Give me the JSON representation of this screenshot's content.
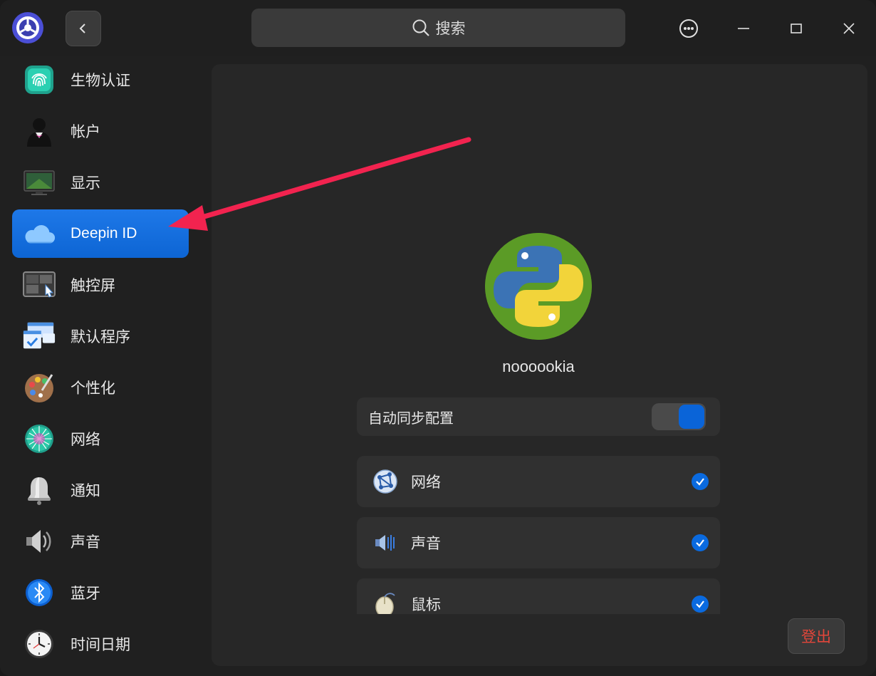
{
  "titlebar": {
    "search_placeholder": "搜索",
    "icons": [
      "control-center-icon",
      "back-icon",
      "search-icon",
      "more-icon",
      "minimize-icon",
      "maximize-icon",
      "close-icon"
    ]
  },
  "sidebar": {
    "items": [
      {
        "label": "生物认证",
        "icon": "fingerprint-icon"
      },
      {
        "label": "帐户",
        "icon": "account-icon"
      },
      {
        "label": "显示",
        "icon": "display-icon"
      },
      {
        "label": "Deepin ID",
        "icon": "cloud-icon",
        "active": true
      },
      {
        "label": "触控屏",
        "icon": "touchscreen-icon"
      },
      {
        "label": "默认程序",
        "icon": "default-apps-icon"
      },
      {
        "label": "个性化",
        "icon": "palette-icon"
      },
      {
        "label": "网络",
        "icon": "network-icon"
      },
      {
        "label": "通知",
        "icon": "bell-icon"
      },
      {
        "label": "声音",
        "icon": "speaker-icon"
      },
      {
        "label": "蓝牙",
        "icon": "bluetooth-icon"
      },
      {
        "label": "时间日期",
        "icon": "clock-icon"
      }
    ]
  },
  "main": {
    "username": "noooookia",
    "auto_sync": {
      "label": "自动同步配置",
      "enabled": true
    },
    "sync_items": [
      {
        "label": "网络",
        "icon": "network-sync-icon",
        "checked": true
      },
      {
        "label": "声音",
        "icon": "sound-sync-icon",
        "checked": true
      },
      {
        "label": "鼠标",
        "icon": "mouse-sync-icon",
        "checked": true
      }
    ],
    "logout_label": "登出"
  },
  "colors": {
    "accent": "#0d6ad8",
    "logout_text": "#e2463a",
    "arrow": "#f2234f"
  }
}
